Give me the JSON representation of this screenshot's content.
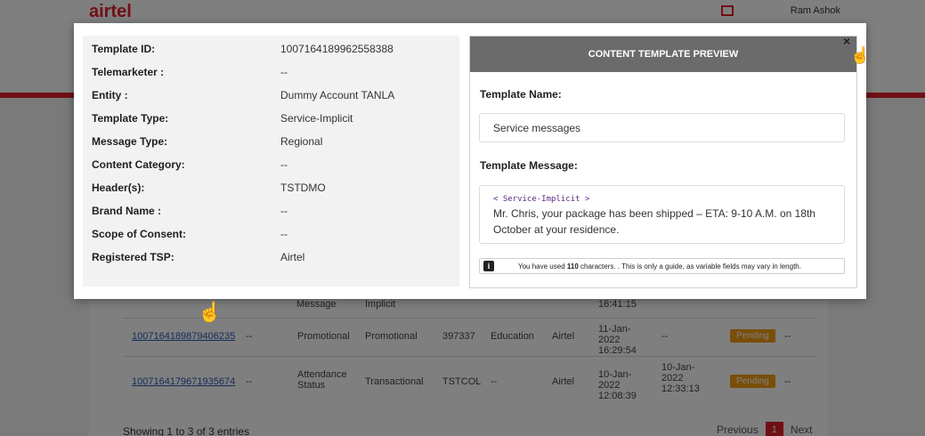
{
  "background": {
    "header_user": "Ram Ashok",
    "rows": [
      {
        "id": "",
        "col2": "",
        "col3": "Message",
        "col4": "Implicit",
        "col5": "",
        "col6": "",
        "col7": "",
        "date": "16:41:15",
        "col9": "",
        "status": "",
        "col11": ""
      },
      {
        "id": "1007164189879406235",
        "col2": "--",
        "col3": "Promotional",
        "col4": "Promotional",
        "col5": "397337",
        "col6": "Education",
        "col7": "Airtel",
        "date": "11-Jan-2022 16:29:54",
        "col9": "--",
        "status": "Pending",
        "col11": "--"
      },
      {
        "id": "1007164179671935674",
        "col2": "--",
        "col3": "Attendance Status",
        "col4": "Transactional",
        "col5": "TSTCOL",
        "col6": "--",
        "col7": "Airtel",
        "date": "10-Jan-2022 12:08:39",
        "col9": "10-Jan-2022 12:33:13",
        "status": "Pending",
        "col11": "--"
      }
    ],
    "footer": "Showing 1 to 3 of 3 entries",
    "pager": {
      "previous": "Previous",
      "page": "1",
      "next": "Next"
    }
  },
  "details": [
    {
      "label": "Template ID:",
      "value": "1007164189962558388"
    },
    {
      "label": "Telemarketer :",
      "value": "--"
    },
    {
      "label": "Entity :",
      "value": "Dummy Account TANLA"
    },
    {
      "label": "Template Type:",
      "value": "Service-Implicit"
    },
    {
      "label": "Message Type:",
      "value": "Regional"
    },
    {
      "label": "Content Category:",
      "value": "--"
    },
    {
      "label": "Header(s):",
      "value": "TSTDMO"
    },
    {
      "label": "Brand Name :",
      "value": "--"
    },
    {
      "label": "Scope of Consent:",
      "value": "--"
    },
    {
      "label": "Registered TSP:",
      "value": "Airtel"
    }
  ],
  "preview": {
    "title": "CONTENT TEMPLATE PREVIEW",
    "close": "×",
    "name_label": "Template Name:",
    "name_value": "Service messages",
    "message_label": "Template Message:",
    "message_tag": "< Service-Implicit >",
    "message_text": "Mr. Chris, your package has been shipped – ETA: 9-10 A.M. on 18th October at your residence.",
    "info_icon": "i",
    "info_prefix": "You have used ",
    "info_count": "110",
    "info_suffix": " characters. . This is only a guide, as variable fields may vary in length."
  },
  "icons": {
    "close": "close-icon",
    "hand_cursor": "pointer-hand-icon",
    "grab_cursor": "grab-hand-icon",
    "info": "info-icon"
  },
  "colors": {
    "brand_red": "#e0212a",
    "header_gray": "#6b6b6b",
    "pending_orange": "#f39c12",
    "link_blue": "#2a5bb5"
  }
}
